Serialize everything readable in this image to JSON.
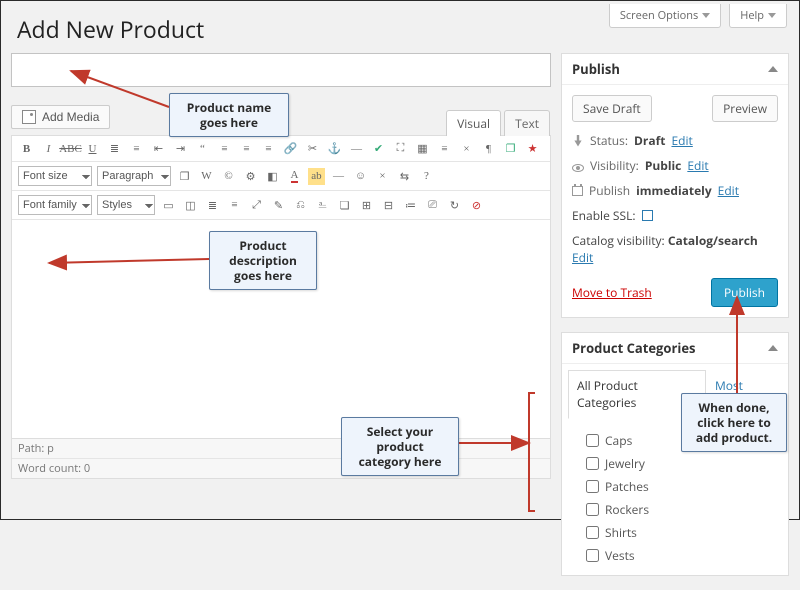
{
  "screen_tabs": {
    "options": "Screen Options",
    "help": "Help"
  },
  "page_title": "Add New Product",
  "title_value": "",
  "add_media": "Add Media",
  "editor_tabs": {
    "visual": "Visual",
    "text": "Text"
  },
  "selects": {
    "font_size": "Font size",
    "paragraph": "Paragraph",
    "font_family": "Font family",
    "styles": "Styles"
  },
  "status_path_label": "Path:",
  "status_path_value": "p",
  "word_count_label": "Word count:",
  "word_count_value": "0",
  "publish": {
    "title": "Publish",
    "save_draft": "Save Draft",
    "preview": "Preview",
    "status_label": "Status:",
    "status_value": "Draft",
    "visibility_label": "Visibility:",
    "visibility_value": "Public",
    "publish_on_label": "Publish",
    "publish_on_value": "immediately",
    "edit": "Edit",
    "ssl_label": "Enable SSL:",
    "catalog_label": "Catalog visibility:",
    "catalog_value": "Catalog/search",
    "trash": "Move to Trash",
    "publish_btn": "Publish"
  },
  "categories": {
    "title": "Product Categories",
    "tab_all": "All Product Categories",
    "tab_used": "Most Used",
    "items": [
      "Caps",
      "Jewelry",
      "Patches",
      "Rockers",
      "Shirts",
      "Vests"
    ]
  },
  "annotations": {
    "name": "Product name\ngoes here",
    "desc": "Product\ndescription\ngoes here",
    "cat": "Select your\nproduct\ncategory here",
    "pub": "When done,\nclick here to\nadd product."
  }
}
